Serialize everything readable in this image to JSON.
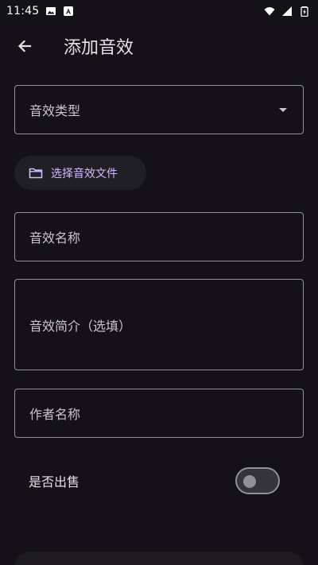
{
  "status_bar": {
    "time": "11:45"
  },
  "app_bar": {
    "title": "添加音效"
  },
  "form": {
    "type_select_placeholder": "音效类型",
    "choose_file_label": "选择音效文件",
    "name_placeholder": "音效名称",
    "desc_placeholder": "音效简介（选填）",
    "author_placeholder": "作者名称",
    "for_sale_label": "是否出售",
    "for_sale_on": false
  },
  "icons": {
    "back": "arrow-back-icon",
    "dropdown": "dropdown-arrow-icon",
    "folder": "folder-icon"
  },
  "colors": {
    "background": "#141218",
    "accent": "#d0bcff",
    "outline": "#938f99"
  }
}
